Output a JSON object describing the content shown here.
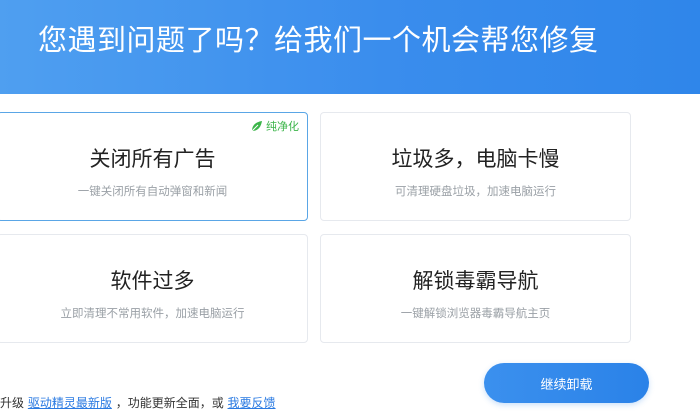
{
  "header": {
    "title": "您遇到问题了吗？给我们一个机会帮您修复"
  },
  "cards": [
    {
      "title": "关闭所有广告",
      "desc": "一键关闭所有自动弹窗和新闻",
      "badge": "纯净化"
    },
    {
      "title": "垃圾多，电脑卡慢",
      "desc": "可清理硬盘垃圾，加速电脑运行"
    },
    {
      "title": "软件过多",
      "desc": "立即清理不常用软件，加速电脑运行"
    },
    {
      "title": "解锁毒霸导航",
      "desc": "一键解锁浏览器毒霸导航主页"
    }
  ],
  "footer": {
    "prefix": "升级",
    "link1": "驱动精灵最新版",
    "middle": "，功能更新全面，或",
    "link2": "我要反馈"
  },
  "continue_button": "继续卸载",
  "colors": {
    "header_start": "#4f9ff0",
    "header_end": "#2f86ea",
    "badge_green": "#3cb54a",
    "link_blue": "#2a7ae2",
    "selected_border": "#5aa6e6"
  }
}
